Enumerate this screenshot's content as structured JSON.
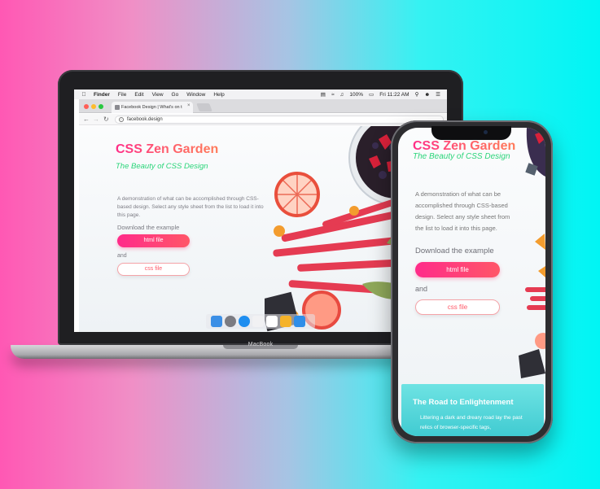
{
  "menubar": {
    "app": "Finder",
    "items": [
      "File",
      "Edit",
      "View",
      "Go",
      "Window",
      "Help"
    ],
    "battery": "100%",
    "clock": "Fri 11:22 AM"
  },
  "browser": {
    "tab_title": "Facebook Design | What's on t",
    "url": "facebook.design"
  },
  "site": {
    "title": "CSS Zen Garden",
    "subtitle": "The Beauty of CSS Design",
    "description": "A demonstration of what can be accomplished through CSS-based design. Select any style sheet from the list to load it into this page.",
    "download_label": "Download the example",
    "html_button": "html file",
    "and_label": "and",
    "css_button": "css file"
  },
  "laptop": {
    "brand": "MacBook"
  },
  "phone_site": {
    "section_title": "The Road to Enlightenment",
    "section_text": "Littering a dark and dreary road lay the past relics of browser-specific tags,"
  },
  "colors": {
    "title_gradient_start": "#ff2d87",
    "title_gradient_end": "#ff7a59",
    "subtitle_green": "#2bd57a",
    "section_cyan": "#4fd8dc"
  }
}
